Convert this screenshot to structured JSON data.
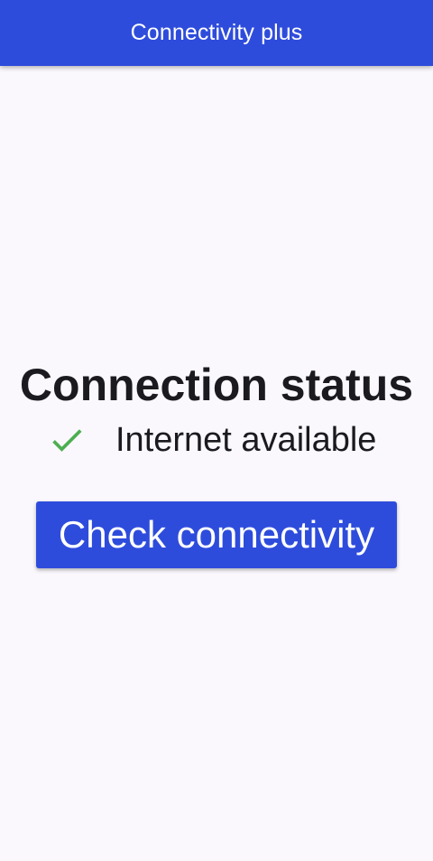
{
  "app_bar": {
    "title": "Connectivity plus"
  },
  "status": {
    "heading": "Connection status",
    "icon": "check-icon",
    "icon_color": "#4caf50",
    "text": "Internet available"
  },
  "actions": {
    "check_label": "Check connectivity"
  },
  "colors": {
    "primary": "#2e4cdc",
    "background": "#faf8fc",
    "text": "#1b1b1f"
  }
}
